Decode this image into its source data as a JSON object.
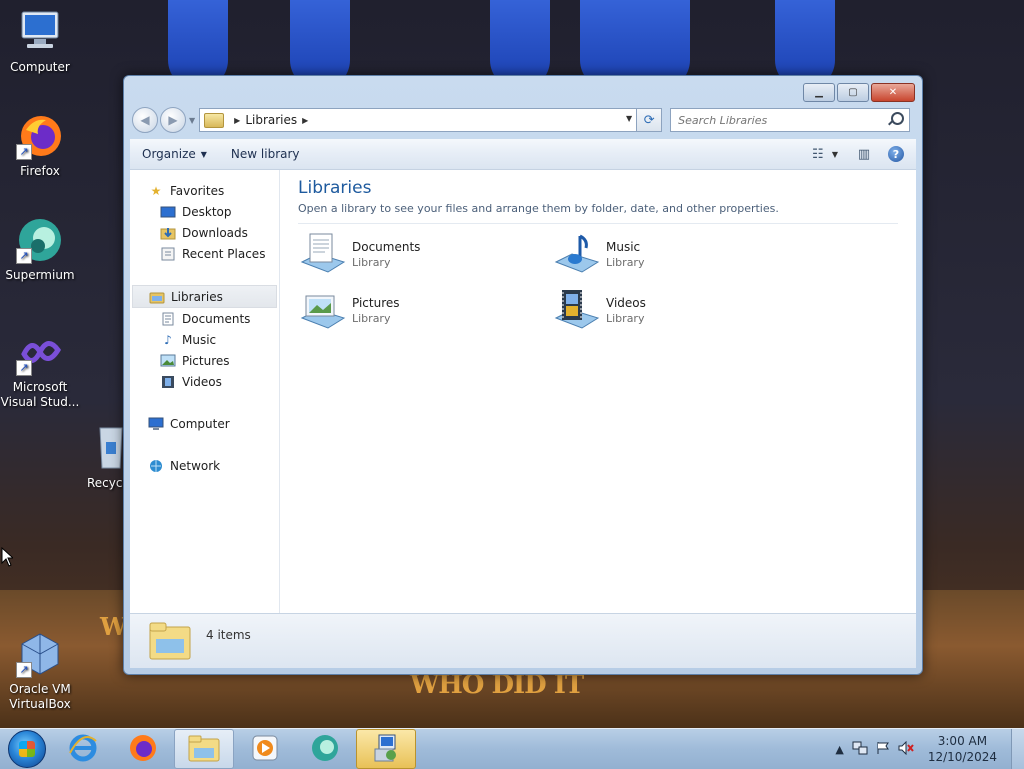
{
  "desktop": {
    "icons": [
      {
        "label": "Computer"
      },
      {
        "label": "Firefox"
      },
      {
        "label": "Supermium"
      },
      {
        "label": "Microsoft Visual Stud..."
      },
      {
        "label": "Recycl"
      },
      {
        "label": "Oracle VM VirtualBox"
      }
    ],
    "wallpaper_text": [
      "WHO DID IT",
      "W"
    ]
  },
  "window": {
    "title": "",
    "address": {
      "crumbs": [
        "Libraries"
      ]
    },
    "search": {
      "placeholder": "Search Libraries"
    },
    "toolbar": {
      "organize_label": "Organize",
      "new_library_label": "New library"
    },
    "nav": {
      "favorites": {
        "label": "Favorites",
        "items": [
          "Desktop",
          "Downloads",
          "Recent Places"
        ]
      },
      "libraries": {
        "label": "Libraries",
        "items": [
          "Documents",
          "Music",
          "Pictures",
          "Videos"
        ]
      },
      "computer": {
        "label": "Computer"
      },
      "network": {
        "label": "Network"
      }
    },
    "main": {
      "title": "Libraries",
      "subtitle": "Open a library to see your files and arrange them by folder, date, and other properties.",
      "items": [
        {
          "name": "Documents",
          "kind": "Library",
          "icon": "documents-library-icon"
        },
        {
          "name": "Music",
          "kind": "Library",
          "icon": "music-library-icon"
        },
        {
          "name": "Pictures",
          "kind": "Library",
          "icon": "pictures-library-icon"
        },
        {
          "name": "Videos",
          "kind": "Library",
          "icon": "videos-library-icon"
        }
      ]
    },
    "status": {
      "count": "4 items"
    }
  },
  "taskbar": {
    "apps": [
      "internet-explorer-icon",
      "firefox-icon",
      "windows-explorer-icon",
      "media-player-icon",
      "supermium-icon",
      "installer-icon"
    ],
    "clock": {
      "time": "3:00 AM",
      "date": "12/10/2024"
    }
  },
  "colors": {
    "accent": "#1e5a9e",
    "taskbar": "#9fbbd9",
    "close": "#c8452e"
  }
}
